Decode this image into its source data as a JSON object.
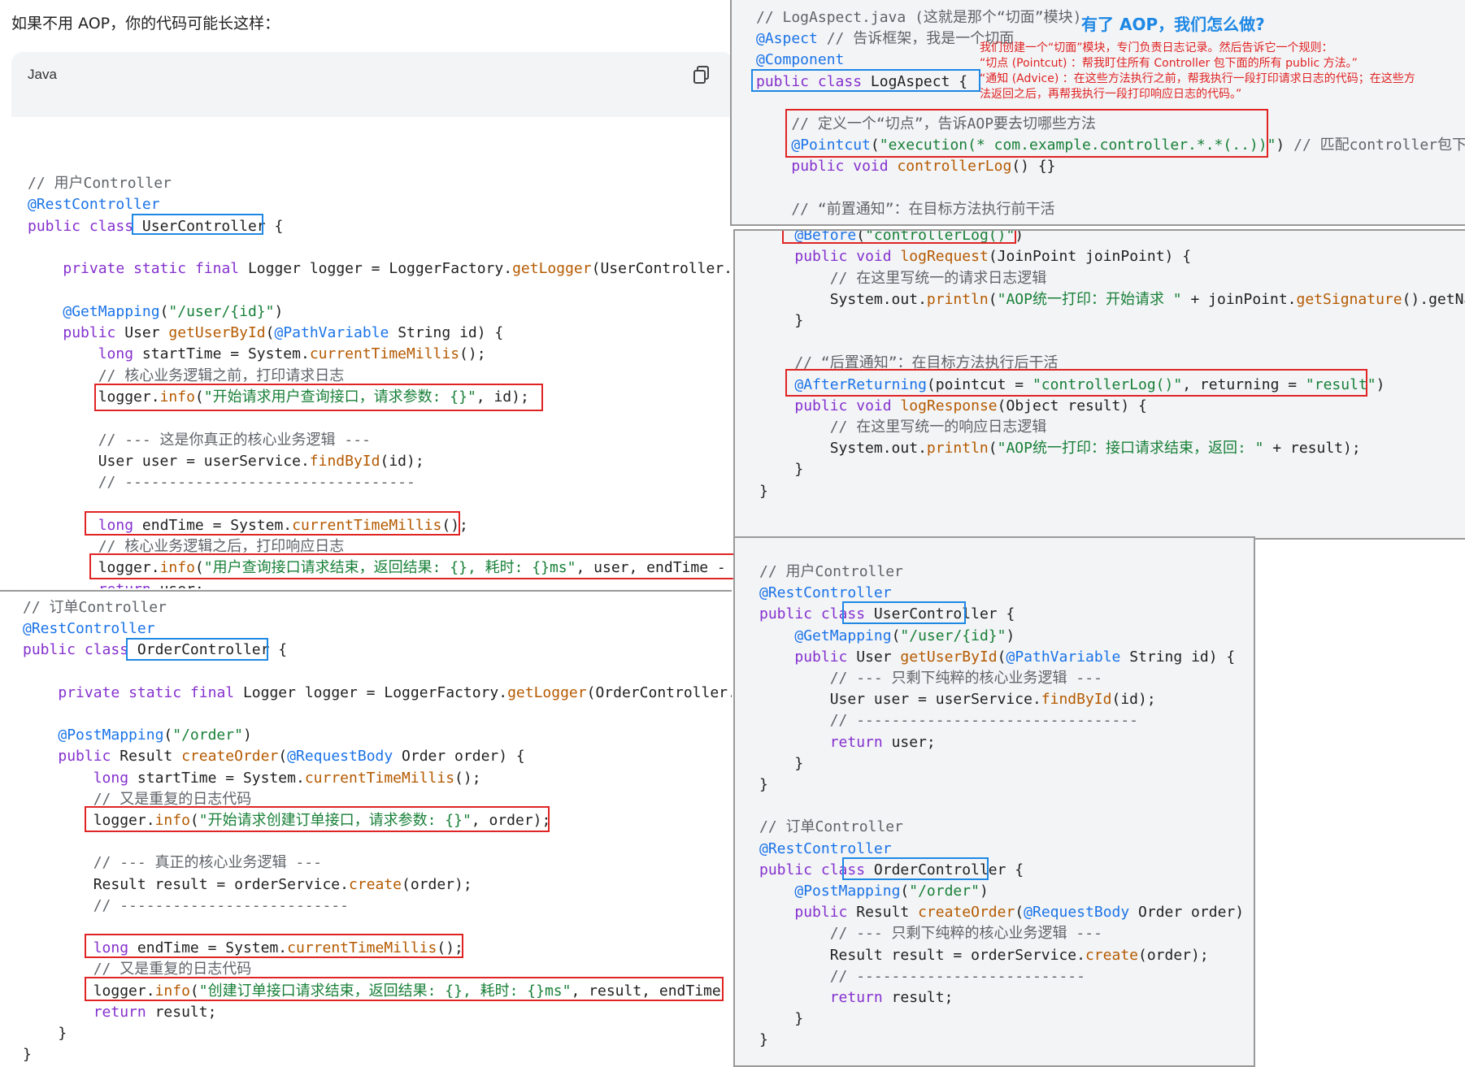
{
  "intro": "如果不用 AOP，你的代码可能长这样：",
  "codeblock": {
    "lang": "Java",
    "copy_icon": "copy-icon"
  },
  "aop_title": "有了 AOP，我们怎么做?",
  "aop_notes": [
    "我们创建一个“切面”模块，专门负责日志记录。然后告诉它一个规则：",
    "“切点 (Pointcut) ：帮我盯住所有 Controller 包下面的所有 public 方法。”",
    "“通知 (Advice) ：在这些方法执行之前，帮我执行一段打印请求日志的代码；在这些方",
    "法返回之后，再帮我执行一段打印响应日志的代码。”"
  ],
  "user_controller_old": [
    "// 用户Controller",
    "@RestController",
    "public class UserController {",
    "",
    "    private static final Logger logger = LoggerFactory.getLogger(UserController.cl",
    "",
    "    @GetMapping(\"/user/{id}\")",
    "    public User getUserById(@PathVariable String id) {",
    "        long startTime = System.currentTimeMillis();",
    "        // 核心业务逻辑之前，打印请求日志",
    "        logger.info(\"开始请求用户查询接口，请求参数: {}\", id);",
    "",
    "        // --- 这是你真正的核心业务逻辑 ---",
    "        User user = userService.findById(id);",
    "        // ---------------------------------",
    "",
    "        long endTime = System.currentTimeMillis();",
    "        // 核心业务逻辑之后，打印响应日志",
    "        logger.info(\"用户查询接口请求结束，返回结果: {}, 耗时: {}ms\", user, endTime - s",
    "        return user;",
    "    }",
    "}"
  ],
  "order_controller_old": [
    "// 订单Controller",
    "@RestController",
    "public class OrderController {",
    "",
    "    private static final Logger logger = LoggerFactory.getLogger(OrderController.cl",
    "",
    "    @PostMapping(\"/order\")",
    "    public Result createOrder(@RequestBody Order order) {",
    "        long startTime = System.currentTimeMillis();",
    "        // 又是重复的日志代码",
    "        logger.info(\"开始请求创建订单接口，请求参数: {}\", order);",
    "",
    "        // --- 真正的核心业务逻辑 ---",
    "        Result result = orderService.create(order);",
    "        // --------------------------",
    "",
    "        long endTime = System.currentTimeMillis();",
    "        // 又是重复的日志代码",
    "        logger.info(\"创建订单接口请求结束，返回结果: {}, 耗时: {}ms\", result, endTime -",
    "        return result;",
    "    }",
    "}"
  ],
  "log_aspect": [
    "// LogAspect.java (这就是那个“切面”模块)",
    "@Aspect // 告诉框架，我是一个切面",
    "@Component",
    "public class LogAspect {",
    "",
    "    // 定义一个“切点”，告诉AOP要去切哪些方法",
    "    @Pointcut(\"execution(* com.example.controller.*.*(..))\") // 匹配controller包下所",
    "    public void controllerLog() {}",
    "",
    "    // “前置通知”：在目标方法执行前干活"
  ],
  "log_aspect_advice": [
    "    // “前置通知”：在目标方法执行前干活",
    "    @Before(\"controllerLog()\")",
    "    public void logRequest(JoinPoint joinPoint) {",
    "        // 在这里写统一的请求日志逻辑",
    "        System.out.println(\"AOP统一打印：开始请求 \" + joinPoint.getSignature().getNam",
    "    }",
    "",
    "    // “后置通知”：在目标方法执行后干活",
    "    @AfterReturning(pointcut = \"controllerLog()\", returning = \"result\")",
    "    public void logResponse(Object result) {",
    "        // 在这里写统一的响应日志逻辑",
    "        System.out.println(\"AOP统一打印：接口请求结束，返回: \" + result);",
    "    }",
    "}"
  ],
  "controllers_new": [
    "// 用户Controller",
    "@RestController",
    "public class UserController {",
    "    @GetMapping(\"/user/{id}\")",
    "    public User getUserById(@PathVariable String id) {",
    "        // --- 只剩下纯粹的核心业务逻辑 ---",
    "        User user = userService.findById(id);",
    "        // --------------------------------",
    "        return user;",
    "    }",
    "}",
    "",
    "// 订单Controller",
    "@RestController",
    "public class OrderController {",
    "    @PostMapping(\"/order\")",
    "    public Result createOrder(@RequestBody Order order) {",
    "        // --- 只剩下纯粹的核心业务逻辑 ---",
    "        Result result = orderService.create(order);",
    "        // --------------------------",
    "        return result;",
    "    }",
    "}"
  ]
}
